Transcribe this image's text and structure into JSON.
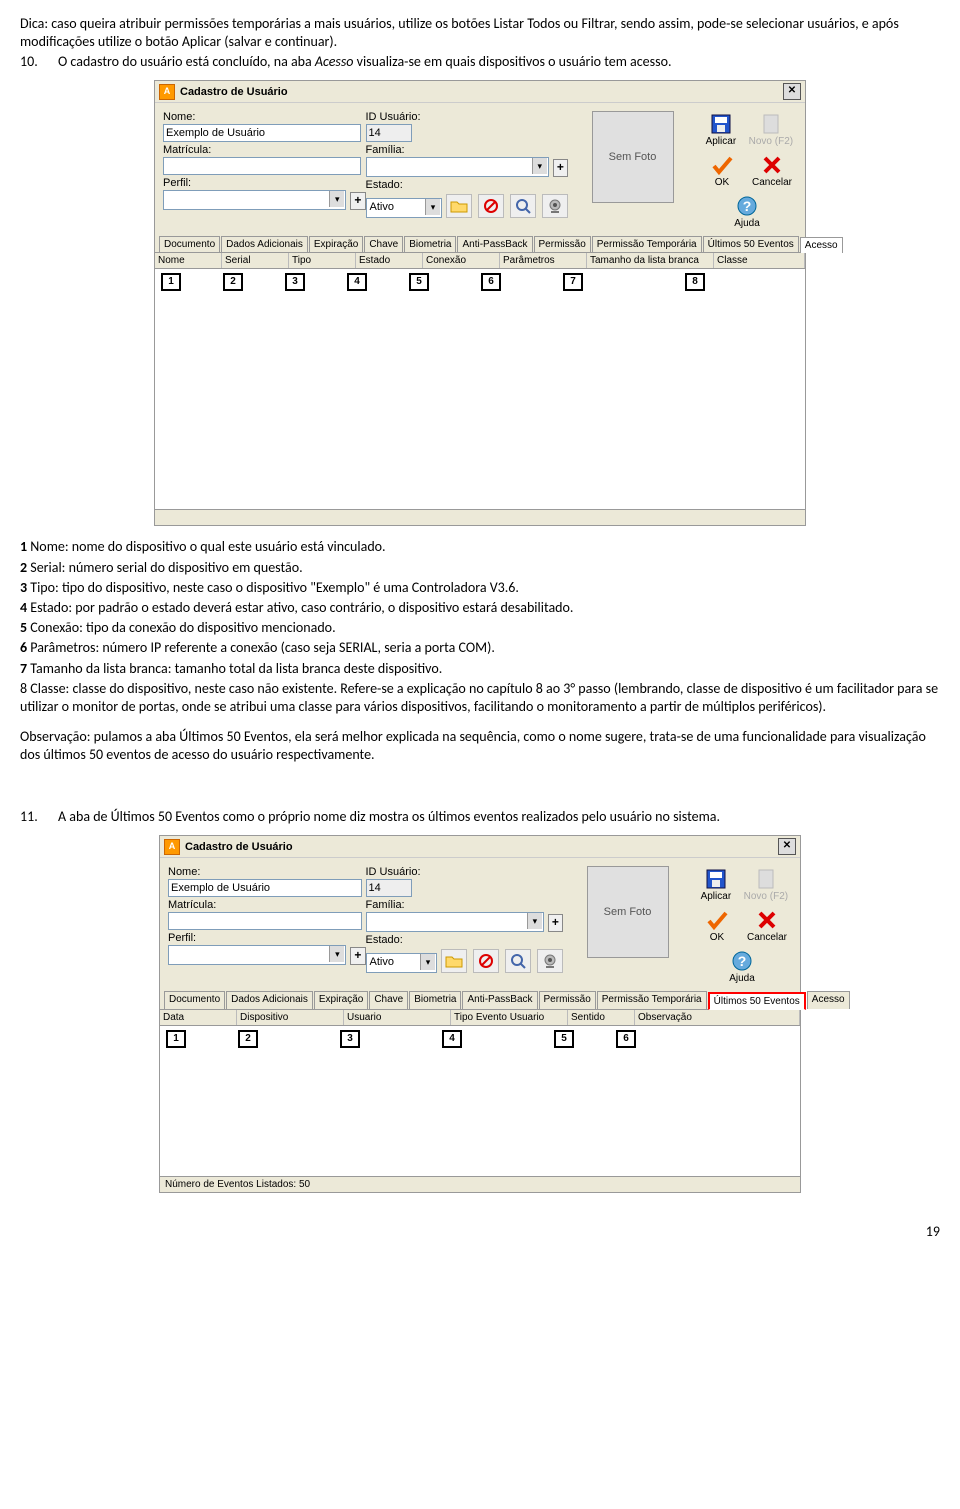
{
  "doc": {
    "tip": "Dica: caso queira atribuir permissões temporárias a mais usuários, utilize os botões Listar Todos ou Filtrar, sendo assim, pode-se selecionar usuários, e após modificações utilize o botão Aplicar (salvar e continuar).",
    "item10num": "10.",
    "item10": "O cadastro do usuário está concluído, na aba Acesso visualiza-se em quais dispositivos o usuário tem acesso.",
    "leg1": "1 Nome: nome do dispositivo o qual este usuário está vinculado.",
    "leg2": "2 Serial: número serial do dispositivo em questão.",
    "leg3": "3 Tipo: tipo do dispositivo, neste caso o dispositivo \"Exemplo\" é uma Controladora V3.6.",
    "leg4": "4 Estado: por padrão o estado deverá estar ativo, caso contrário, o dispositivo estará desabilitado.",
    "leg5": "5 Conexão: tipo da conexão do dispositivo mencionado.",
    "leg6": "6 Parâmetros: número IP referente a conexão (caso seja SERIAL, seria a porta COM).",
    "leg7": "7 Tamanho da lista branca: tamanho total da lista branca deste dispositivo.",
    "leg8": "8 Classe: classe do dispositivo, neste caso não existente. Refere-se a explicação no capítulo 8 ao 3° passo (lembrando, classe de dispositivo é um facilitador para se utilizar o monitor de portas, onde se atribui uma classe para vários dispositivos, facilitando o monitoramento a partir de múltiplos periféricos).",
    "obs": "Observação: pulamos a aba Últimos 50 Eventos, ela será melhor explicada na sequência, como o nome sugere, trata-se de uma funcionalidade para visualização dos últimos 50 eventos de acesso do usuário respectivamente.",
    "item11num": "11.",
    "item11": "A aba de Últimos 50 Eventos como o próprio nome diz mostra os últimos eventos realizados pelo usuário no sistema.",
    "pagenum": "19"
  },
  "win": {
    "title": "Cadastro de Usuário",
    "lblNome": "Nome:",
    "valNome": "Exemplo de Usuário",
    "lblId": "ID Usuário:",
    "valId": "14",
    "lblMat": "Matrícula:",
    "lblFam": "Família:",
    "lblPerfil": "Perfil:",
    "lblEstado": "Estado:",
    "valEstado": "Ativo",
    "semfoto": "Sem Foto",
    "aplicar": "Aplicar",
    "novo": "Novo (F2)",
    "ok": "OK",
    "cancelar": "Cancelar",
    "ajuda": "Ajuda",
    "status2": "Número de Eventos Listados:  50"
  },
  "tabs": [
    "Documento",
    "Dados Adicionais",
    "Expiração",
    "Chave",
    "Biometria",
    "Anti-PassBack",
    "Permissão",
    "Permissão Temporária",
    "Últimos 50 Eventos",
    "Acesso"
  ],
  "cols1": [
    "Nome",
    "Serial",
    "Tipo",
    "Estado",
    "Conexão",
    "Parâmetros",
    "Tamanho da lista branca",
    "Classe"
  ],
  "nums1": [
    "1",
    "2",
    "3",
    "4",
    "5",
    "6",
    "7",
    "8"
  ],
  "cols2": [
    "Data",
    "Dispositivo",
    "Usuario",
    "Tipo Evento Usuario",
    "Sentido",
    "Observação"
  ],
  "nums2": [
    "1",
    "2",
    "3",
    "4",
    "5",
    "6"
  ]
}
